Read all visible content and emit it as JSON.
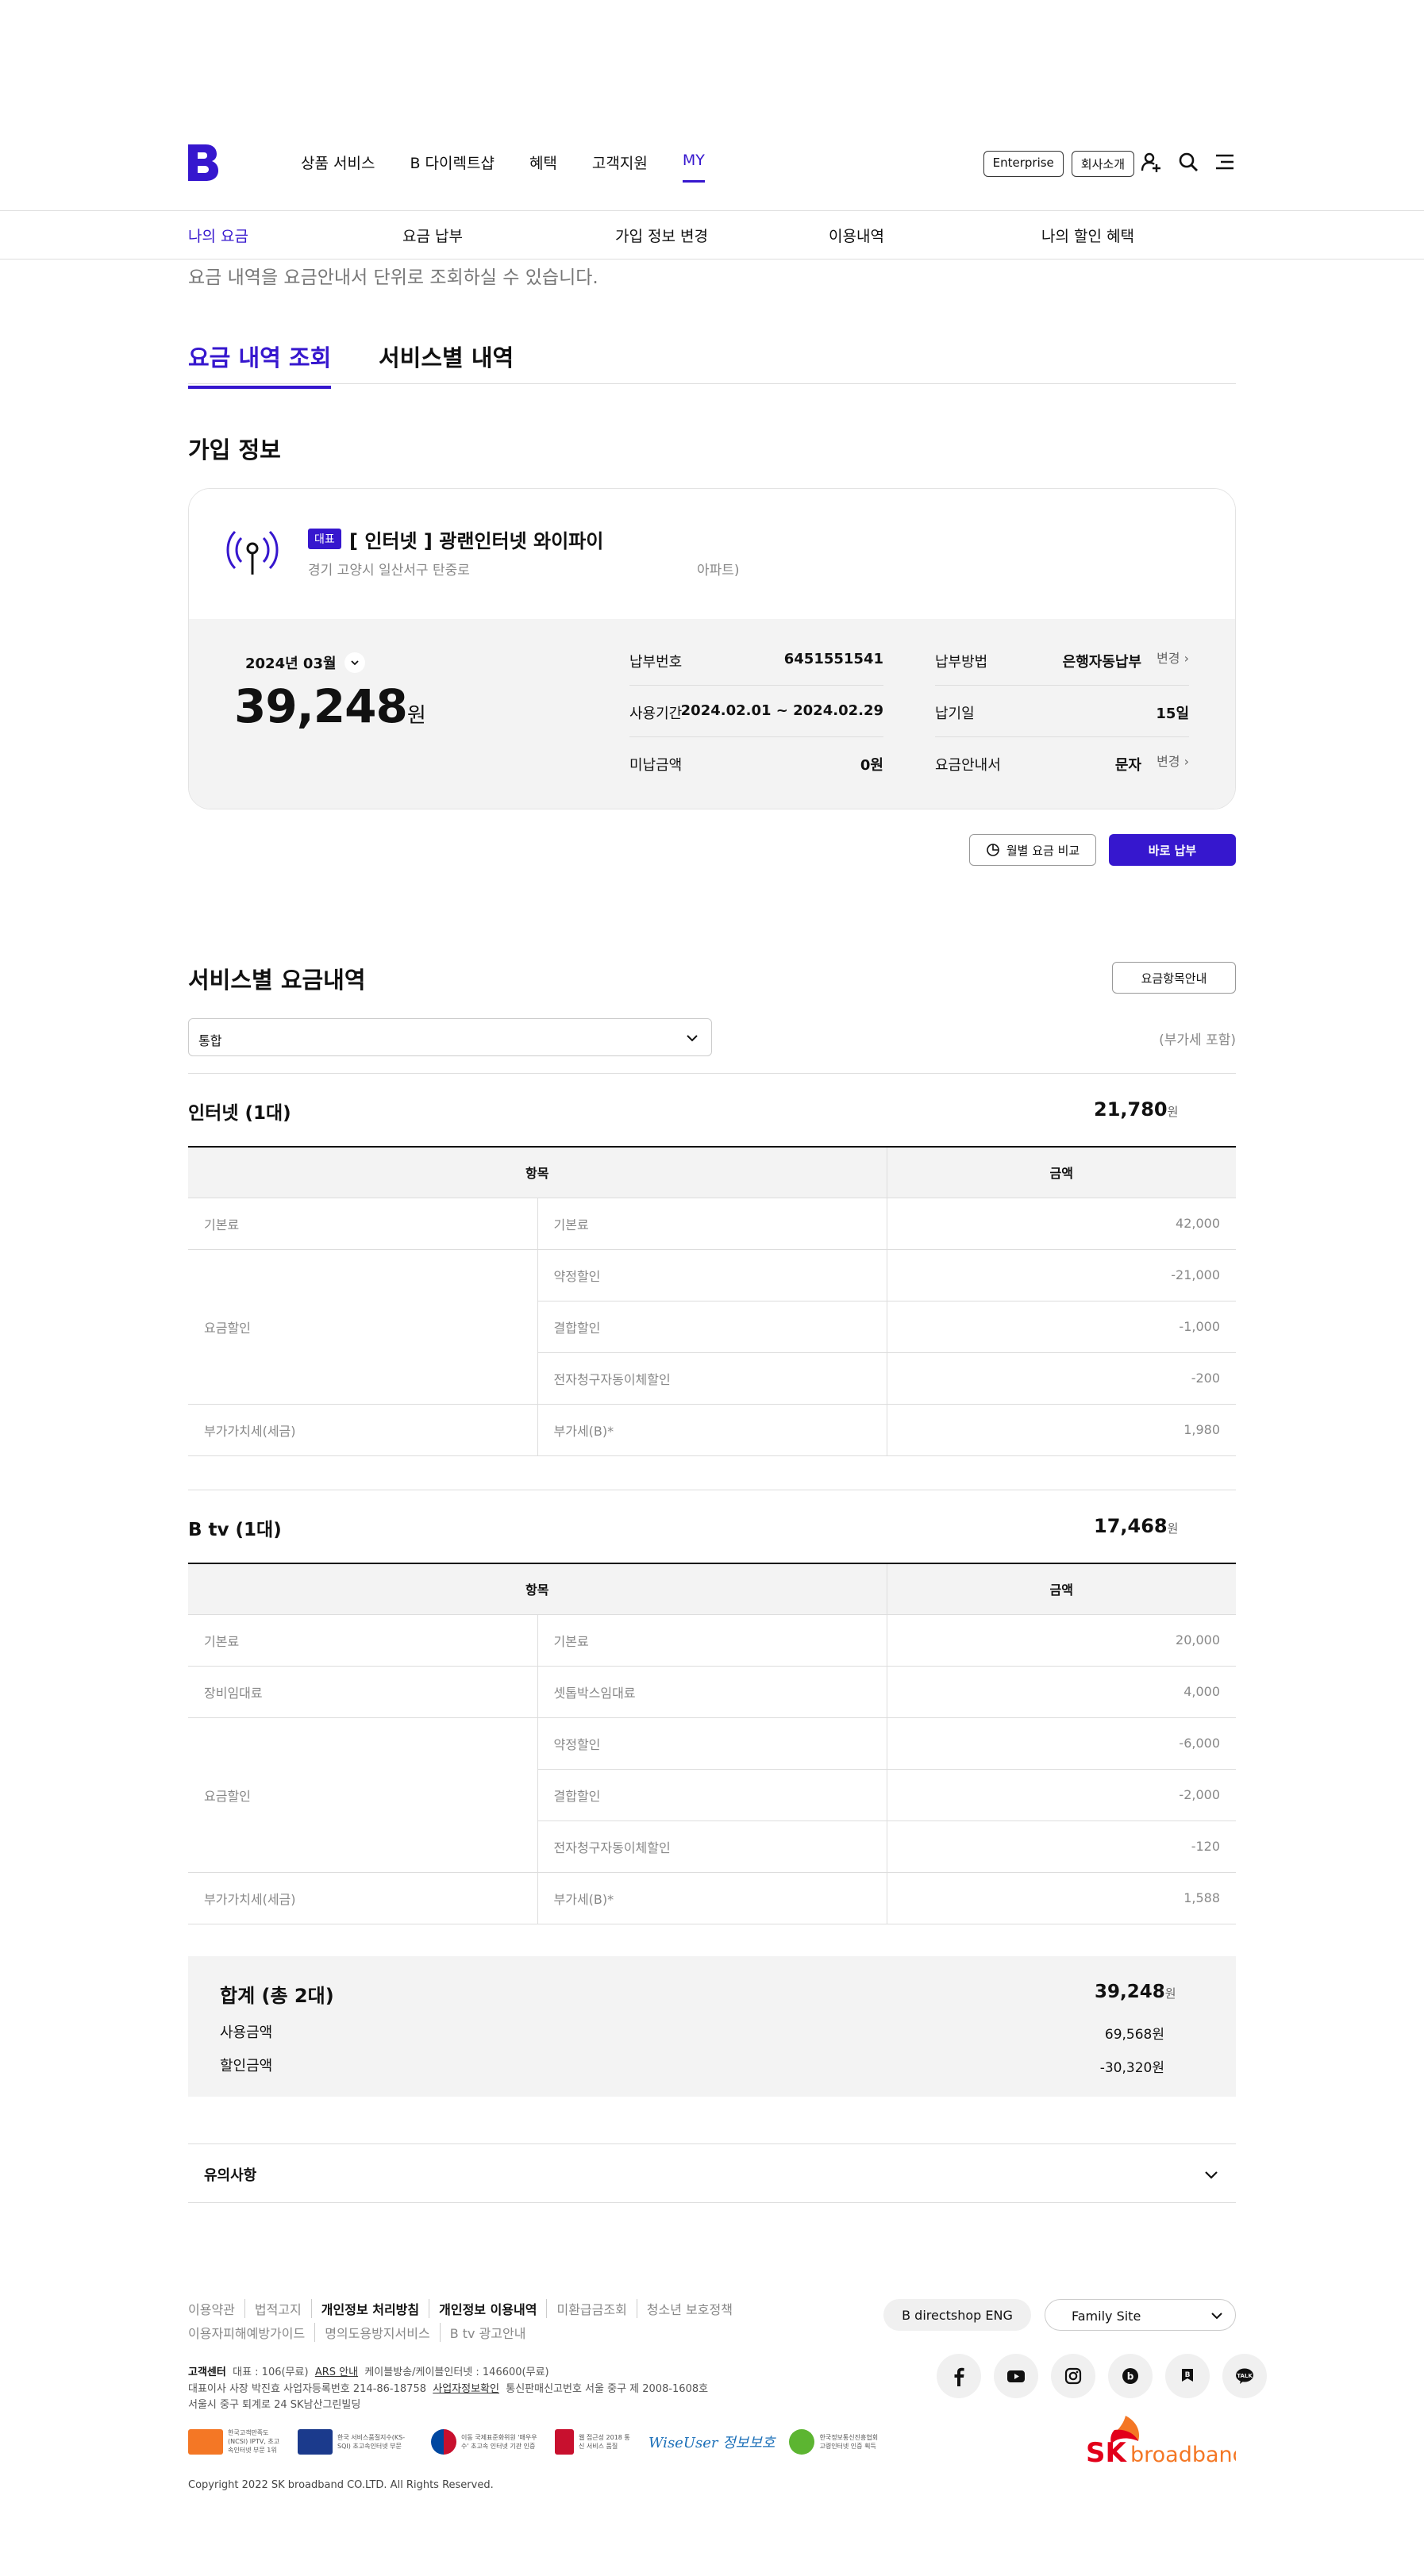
{
  "header": {
    "nav": [
      "상품 서비스",
      "B 다이렉트샵",
      "혜택",
      "고객지원",
      "MY"
    ],
    "enterprise": "Enterprise",
    "company": "회사소개"
  },
  "lnb": [
    "나의 요금",
    "요금 납부",
    "가입 정보 변경",
    "이용내역",
    "나의 할인 혜택"
  ],
  "intro": "요금 내역을 요금안내서 단위로 조회하실 수 있습니다.",
  "tabs": [
    "요금 내역 조회",
    "서비스별 내역"
  ],
  "join": {
    "title": "가입 정보",
    "badge": "대표",
    "service": "[ 인터넷 ] 광랜인터넷 와이파이",
    "address": "경기 고양시 일산서구 탄중로",
    "address_tail": "아파트)",
    "month": "2024년 03월",
    "amount": "39,248",
    "won": "원",
    "rows_left": [
      {
        "k": "납부번호",
        "v": "6451551541"
      },
      {
        "k": "사용기간",
        "v": "2024.02.01 ~ 2024.02.29"
      },
      {
        "k": "미납금액",
        "v": "0원"
      }
    ],
    "rows_right": [
      {
        "k": "납부방법",
        "v": "은행자동납부"
      },
      {
        "k": "납기일",
        "v": "15일"
      },
      {
        "k": "요금안내서",
        "v": "문자"
      }
    ],
    "change": "변경",
    "compare_btn": "월별 요금 비교",
    "pay_btn": "바로 납부"
  },
  "service_bill": {
    "title": "서비스별 요금내역",
    "guide_btn": "요금항목안내",
    "select": "통합",
    "vat_note": "(부가세 포함)",
    "col_item": "항목",
    "col_amount": "금액",
    "groups": [
      {
        "title": "인터넷 (1대)",
        "amount": "21,780",
        "rows": [
          [
            "기본료",
            "기본료",
            "42,000"
          ],
          [
            "요금할인",
            "약정할인",
            "-21,000"
          ],
          [
            "",
            "결합할인",
            "-1,000"
          ],
          [
            "",
            "전자청구자동이체할인",
            "-200"
          ],
          [
            "부가가치세(세금)",
            "부가세(B)*",
            "1,980"
          ]
        ]
      },
      {
        "title": "B tv (1대)",
        "amount": "17,468",
        "rows": [
          [
            "기본료",
            "기본료",
            "20,000"
          ],
          [
            "장비임대료",
            "셋톱박스임대료",
            "4,000"
          ],
          [
            "요금할인",
            "약정할인",
            "-6,000"
          ],
          [
            "",
            "결합할인",
            "-2,000"
          ],
          [
            "",
            "전자청구자동이체할인",
            "-120"
          ],
          [
            "부가가치세(세금)",
            "부가세(B)*",
            "1,588"
          ]
        ]
      }
    ],
    "won": "원"
  },
  "total": {
    "title": "합계 (총 2대)",
    "amount": "39,248",
    "use_label": "사용금액",
    "use_value": "69,568원",
    "disc_label": "할인금액",
    "disc_value": "-30,320원"
  },
  "notice": "유의사항",
  "footer": {
    "links1": [
      "이용약관",
      "법적고지",
      "개인정보 처리방침",
      "개인정보 이용내역",
      "미환급금조회",
      "청소년 보호정책"
    ],
    "links2": [
      "이용자피해예방가이드",
      "명의도용방지서비스",
      "B tv 광고안내"
    ],
    "cs_title": "고객센터",
    "cs_line1": "대표 : 106(무료)",
    "ars": "ARS 안내",
    "cs_line1b": "케이블방송/케이블인터넷 : 146600(무료)",
    "biz_line": "대표이사 사장 박진효   사업자등록번호 214-86-18758",
    "biz_link": "사업자정보확인",
    "biz_line2": "통신판매신고번호 서울 중구 제 2008-1608호",
    "address": "서울시 중구 퇴계로 24 SK남산그린빌딩",
    "directshop": "B directshop ENG",
    "family": "Family Site",
    "certs": [
      "한국고객만족도(NCSI) IPTV, 초고속인터넷 부문 1위",
      "한국 서비스품질지수(KS-SQI) 초고속인터넷 부문",
      "이동 국제표준화위원 '매우우수' 초고속 인터넷 기관 인증",
      "웹 접근성 2018 통신 서비스 품질",
      "WiseUser 정보보호",
      "한국정보통신진흥협회 고령인터넷 인증 획득"
    ],
    "copyright": "Copyright 2022 SK broadband CO.LTD. All Rights Reserved."
  },
  "colors": {
    "accent": "#3617ce",
    "sk_red": "#e2001a",
    "sk_orange": "#f47725"
  }
}
